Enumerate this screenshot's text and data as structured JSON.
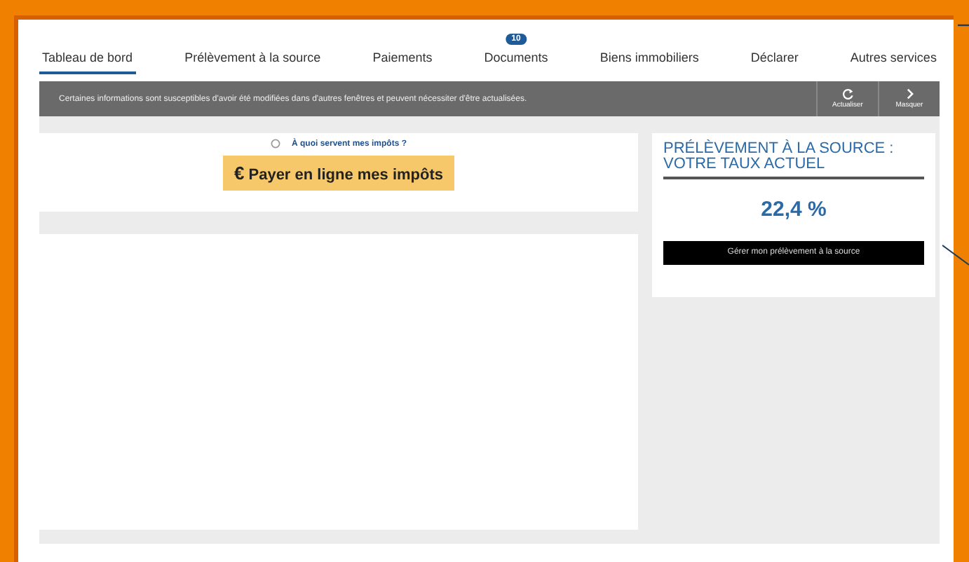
{
  "tabs": [
    {
      "label": "Tableau de bord",
      "selected": true
    },
    {
      "label": "Prélèvement à la source",
      "selected": false
    },
    {
      "label": "Paiements",
      "selected": false
    },
    {
      "label": "Documents",
      "selected": false,
      "badge": "10"
    },
    {
      "label": "Biens immobiliers",
      "selected": false
    },
    {
      "label": "Déclarer",
      "selected": false
    },
    {
      "label": "Autres services",
      "selected": false
    }
  ],
  "notice": {
    "message": "Certaines informations sont susceptibles d'avoir été modifiées dans d'autres fenêtres et peuvent nécessiter d'être actualisées.",
    "refresh_label": "Actualiser",
    "hide_label": "Masquer"
  },
  "payment_card": {
    "info_link": "À quoi servent mes impôts ?",
    "pay_button": "Payer en ligne mes impôts",
    "currency_symbol": "€"
  },
  "rate_card": {
    "title": "PRÉLÈVEMENT À LA SOURCE : VOTRE TAUX ACTUEL",
    "rate": "22,4 %",
    "manage_button": "Gérer mon prélèvement à la source"
  }
}
